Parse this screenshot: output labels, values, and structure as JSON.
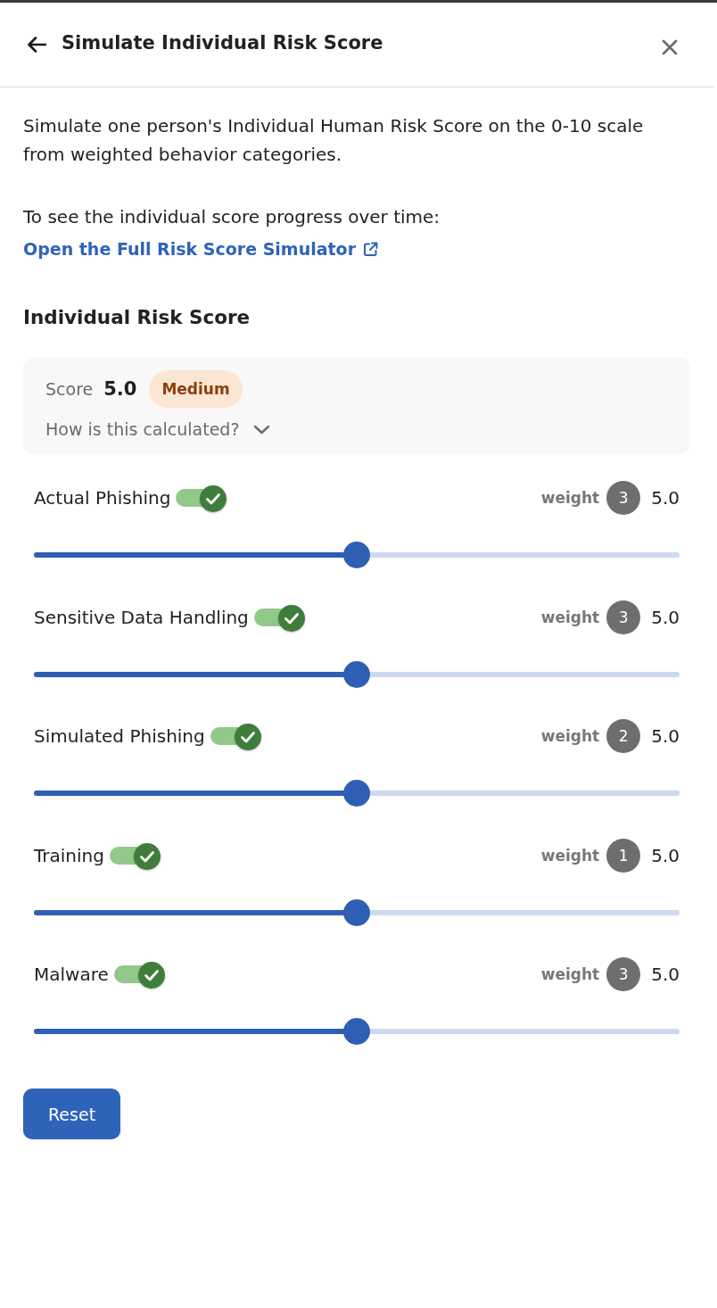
{
  "header": {
    "title": "Simulate Individual Risk Score"
  },
  "intro": {
    "description": "Simulate one person's Individual Human Risk Score on the 0-10 scale from weighted behavior categories.",
    "prompt": "To see the individual score progress over time:",
    "link": "Open the Full Risk Score Simulator"
  },
  "section_title": "Individual Risk Score",
  "score": {
    "label": "Score",
    "value": "5.0",
    "level_tag": "Medium",
    "explainer": "How is this calculated?",
    "expanded": false
  },
  "categories": [
    {
      "name": "Actual Phishing",
      "on": true,
      "weight_label": "weight",
      "weight": "3",
      "value": "5.0",
      "level": 0.5
    },
    {
      "name": "Sensitive Data Handling",
      "on": true,
      "weight_label": "weight",
      "weight": "3",
      "value": "5.0",
      "level": 0.5
    },
    {
      "name": "Simulated Phishing",
      "on": true,
      "weight_label": "weight",
      "weight": "2",
      "value": "5.0",
      "level": 0.5
    },
    {
      "name": "Training",
      "on": true,
      "weight_label": "weight",
      "weight": "1",
      "value": "5.0",
      "level": 0.5
    },
    {
      "name": "Malware",
      "on": true,
      "weight_label": "weight",
      "weight": "3",
      "value": "5.0",
      "level": 0.5
    }
  ],
  "buttons": [
    {
      "label": "Reset"
    }
  ]
}
